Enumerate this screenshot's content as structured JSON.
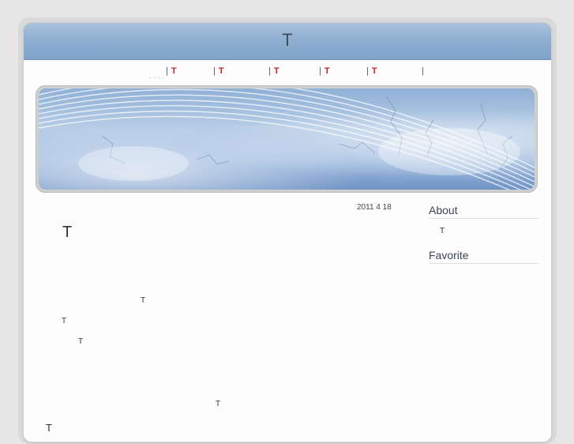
{
  "site": {
    "title": "T"
  },
  "nav": {
    "items": [
      {
        "label": "T"
      },
      {
        "label": "T"
      },
      {
        "label": "T"
      },
      {
        "label": "T"
      },
      {
        "label": "T"
      }
    ],
    "separator": "|",
    "dots": "- - - -"
  },
  "post": {
    "date": "2011 4 18",
    "title": "T",
    "lines": [
      "T",
      "T",
      "T",
      "T",
      "T"
    ]
  },
  "sidebar": {
    "about": {
      "heading": "About",
      "text": "T"
    },
    "favorite": {
      "heading": "Favorite"
    }
  }
}
